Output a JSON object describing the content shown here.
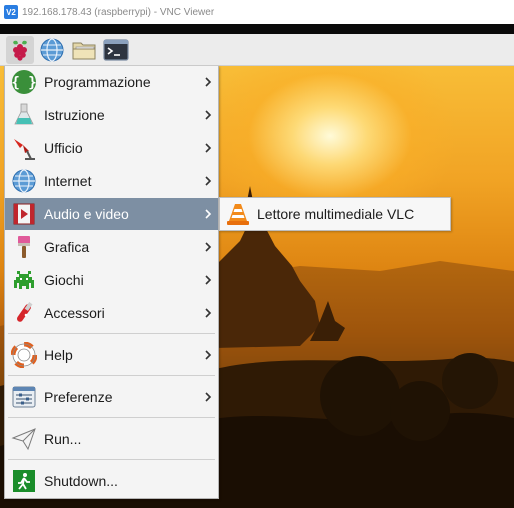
{
  "window": {
    "icon_text": "V2",
    "title_host": "192.168.178.43 (raspberrypi)",
    "title_sep": " - ",
    "title_app": "VNC Viewer"
  },
  "taskbar": {
    "buttons": [
      {
        "icon": "raspberry-icon"
      },
      {
        "icon": "web-browser-icon"
      },
      {
        "icon": "file-manager-icon"
      },
      {
        "icon": "terminal-icon"
      }
    ]
  },
  "menu": {
    "items": [
      {
        "label": "Programmazione",
        "icon": "programming-icon",
        "submenu": true
      },
      {
        "label": "Istruzione",
        "icon": "education-icon",
        "submenu": true
      },
      {
        "label": "Ufficio",
        "icon": "office-icon",
        "submenu": true
      },
      {
        "label": "Internet",
        "icon": "internet-icon",
        "submenu": true
      },
      {
        "label": "Audio e video",
        "icon": "audio-video-icon",
        "submenu": true,
        "selected": true
      },
      {
        "label": "Grafica",
        "icon": "graphics-icon",
        "submenu": true
      },
      {
        "label": "Giochi",
        "icon": "games-icon",
        "submenu": true
      },
      {
        "label": "Accessori",
        "icon": "accessories-icon",
        "submenu": true
      },
      {
        "label": "Help",
        "icon": "help-icon",
        "submenu": true
      },
      {
        "label": "Preferenze",
        "icon": "preferences-icon",
        "submenu": true
      },
      {
        "label": "Run...",
        "icon": "run-icon",
        "submenu": false
      },
      {
        "label": "Shutdown...",
        "icon": "shutdown-icon",
        "submenu": false
      }
    ]
  },
  "submenu": {
    "items": [
      {
        "label": "Lettore multimediale VLC",
        "icon": "vlc-icon"
      }
    ]
  },
  "colors": {
    "selection": "#7d8fa3",
    "menu_background": "#f4f4f4"
  }
}
